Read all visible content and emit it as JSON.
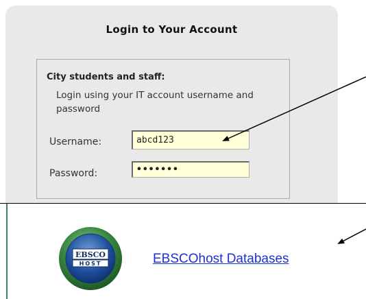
{
  "login": {
    "title": "Login to Your Account",
    "group_heading": "City students and staff:",
    "help_text": "Login using your IT account username and password",
    "username_label": "Username:",
    "username_value": "abcd123",
    "password_label": "Password:",
    "password_display": "•••••••"
  },
  "databases": {
    "logo_text_top": "EBSCO",
    "logo_text_bottom": "HOST",
    "link_label": "EBSCOhost Databases"
  },
  "colors": {
    "panel_bg": "#e9e9e9",
    "input_bg": "#ffffd8",
    "link": "#1d2fd9",
    "logo_green": "#3d8a45"
  }
}
